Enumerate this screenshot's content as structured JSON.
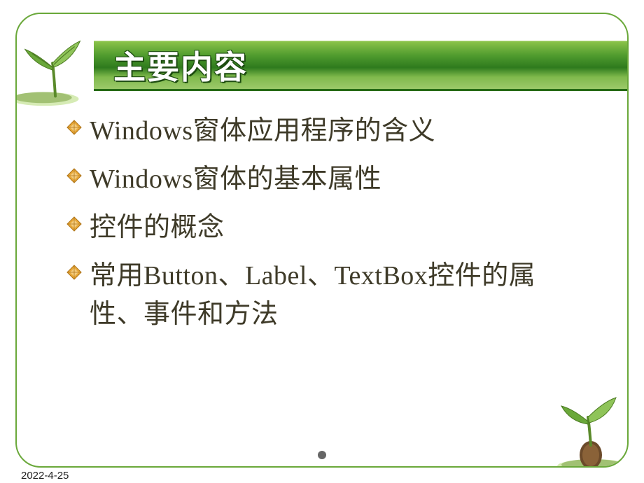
{
  "title": "主要内容",
  "bullets": [
    "Windows窗体应用程序的含义",
    "Windows窗体的基本属性",
    "控件的概念",
    "常用Button、Label、TextBox控件的属性、事件和方法"
  ],
  "footer_date": "2022-4-25",
  "colors": {
    "frame_border": "#6aa83a",
    "bullet_fill": "#e8a93a",
    "bullet_stroke": "#b07518"
  }
}
